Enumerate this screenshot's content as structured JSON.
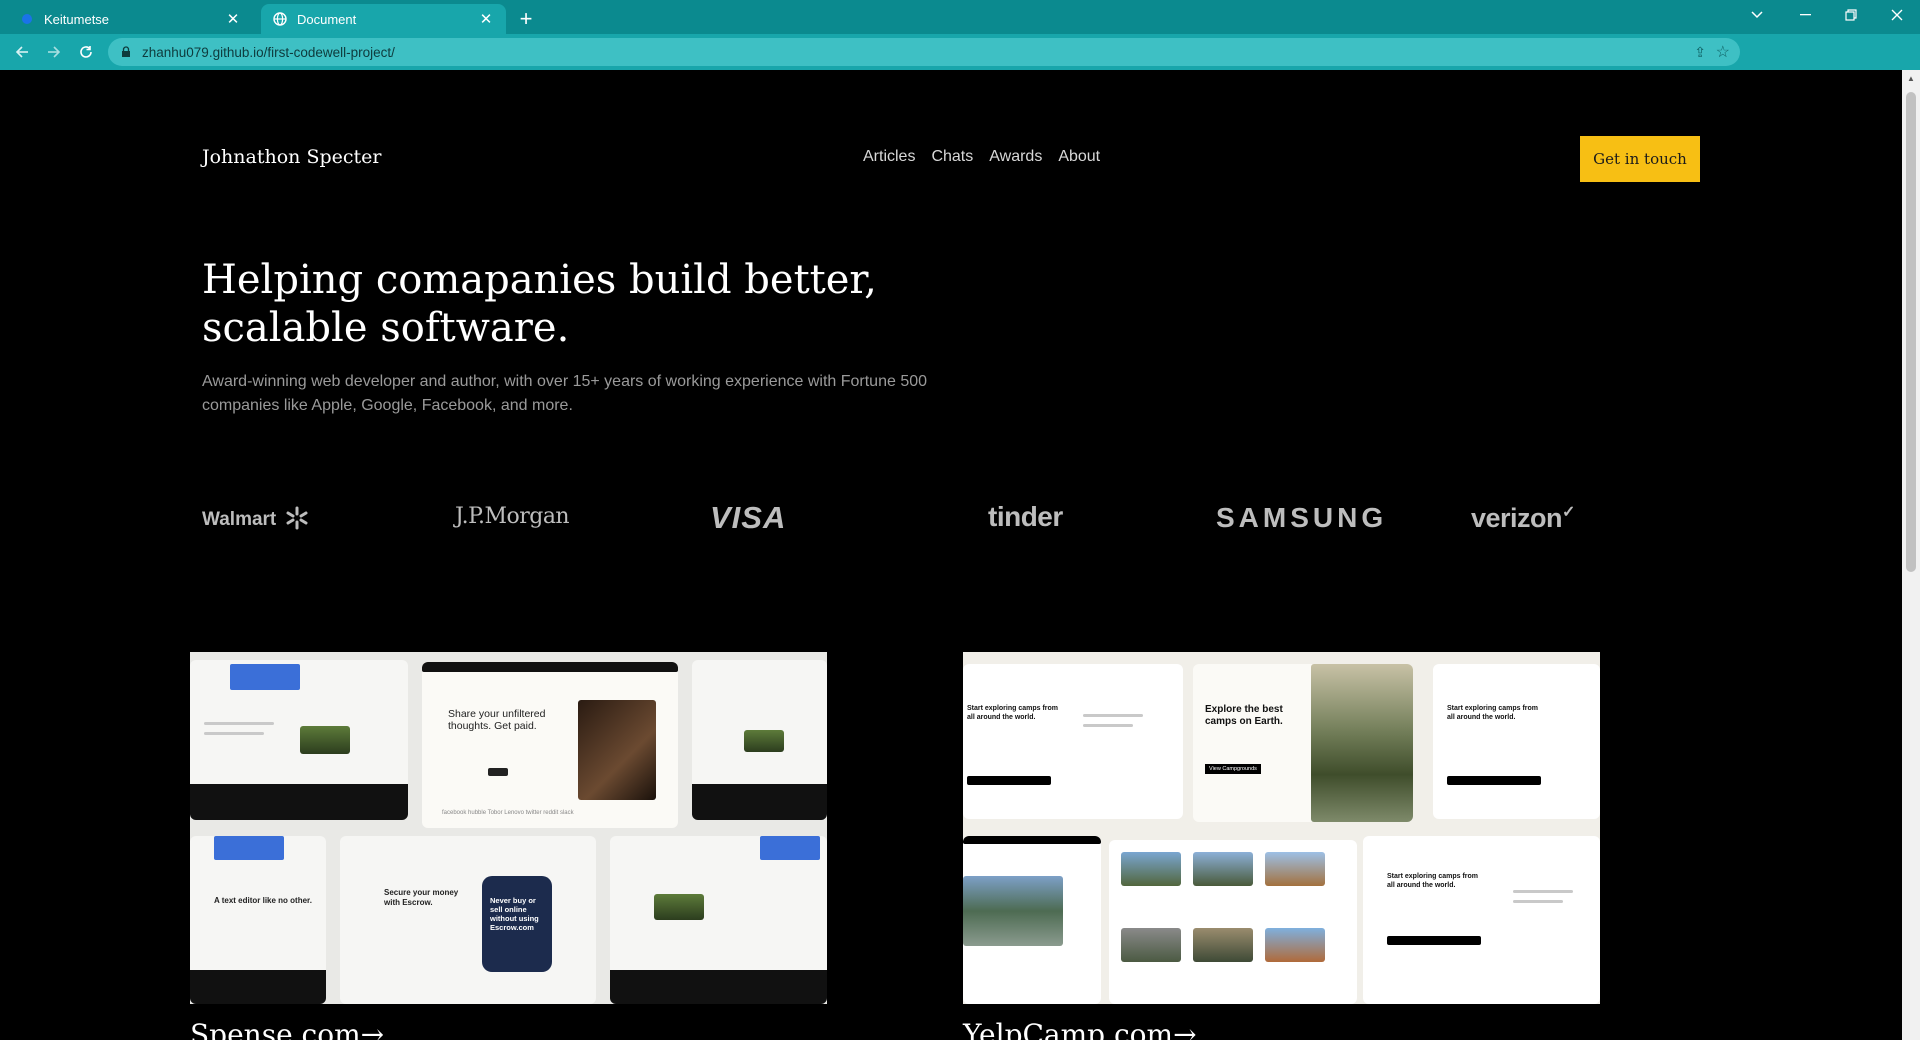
{
  "browser": {
    "tabs": [
      {
        "title": "Keitumetse",
        "active": false
      },
      {
        "title": "Document",
        "active": true
      }
    ],
    "url": "zhanhu079.github.io/first-codewell-project/",
    "colors": {
      "tabbar": "#0b8a8f",
      "toolbar": "#18a6ab"
    }
  },
  "site": {
    "brand": "Johnathon Specter",
    "nav": [
      "Articles",
      "Chats",
      "Awards",
      "About"
    ],
    "cta": "Get in touch",
    "hero_line1": "Helping comapanies build better,",
    "hero_line2": "scalable software.",
    "subtitle": "Award-winning web developer and author, with over 15+ years of working experience with Fortune 500 companies like Apple, Google, Facebook, and more.",
    "logos": [
      "Walmart",
      "J.P.Morgan",
      "VISA",
      "tinder",
      "SAMSUNG",
      "verizon"
    ],
    "projects": [
      {
        "title": "Spense.com→",
        "shot": {
          "hero_text": "Share your unfiltered thoughts. Get paid.",
          "money_text": "Secure your money with Escrow.",
          "phone_text": "Never buy or sell online without using Escrow.com",
          "editor_text": "A text editor like no other.",
          "brands": "facebook  hubble  Tobor  Lenovo  twitter  reddit  slack"
        }
      },
      {
        "title": "YelpCamp.com→",
        "shot": {
          "hero_text": "Explore the best camps on Earth.",
          "start_text": "Start exploring camps from all around the world.",
          "button_text": "View Campgrounds"
        }
      }
    ],
    "colors": {
      "accent": "#f7bf14",
      "background": "#000000"
    }
  }
}
